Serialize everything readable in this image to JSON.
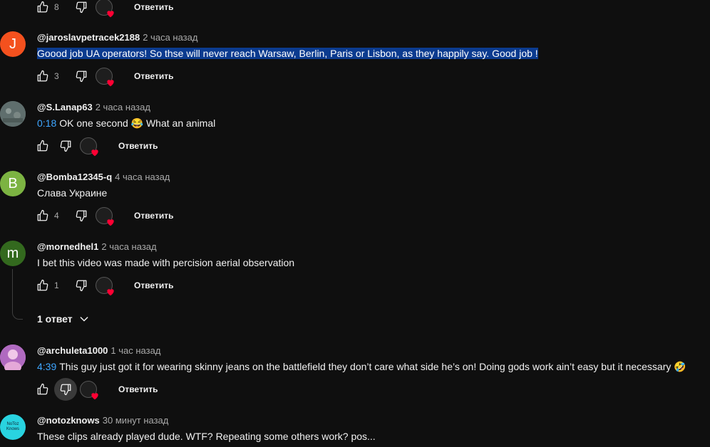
{
  "comments": [
    {
      "author": "",
      "time": "",
      "likes": "8",
      "reply_label": "Ответить"
    },
    {
      "avatar_letter": "J",
      "avatar_color": "#f4511e",
      "author": "@jaroslavpetracek2188",
      "time": "2 часа назад",
      "text": "Goood job UA operators! So thse will never reach Warsaw, Berlin, Paris or Lisbon, as they happily say. Good job !",
      "likes": "3",
      "reply_label": "Ответить"
    },
    {
      "avatar_color": "#6b7a7a",
      "author": "@S.Lanap63",
      "time": "2 часа назад",
      "timestamp_link": "0:18",
      "text": "OK one second 😂  What an animal",
      "likes": "",
      "reply_label": "Ответить"
    },
    {
      "avatar_letter": "B",
      "avatar_color": "#7cb342",
      "author": "@Bomba12345-q",
      "time": "4 часа назад",
      "text": "Слава Украине",
      "likes": "4",
      "reply_label": "Ответить"
    },
    {
      "avatar_letter": "m",
      "avatar_color": "#33691e",
      "author": "@mornedhel1",
      "time": "2 часа назад",
      "text": "I bet this video was made with percision aerial observation",
      "likes": "1",
      "reply_label": "Ответить",
      "replies_label": "1 ответ"
    },
    {
      "avatar_color": "#c27bd0",
      "author": "@archuleta1000",
      "time": "1 час назад",
      "timestamp_link": "4:39",
      "text": "This guy just got it for wearing skinny jeans on the battlefield they don’t care what side he’s on! Doing gods work ain’t easy but it necessary 🤣",
      "likes": "",
      "reply_label": "Ответить"
    },
    {
      "avatar_color": "#29d3e0",
      "avatar_logo_text": "NoToz Knows",
      "author": "@notozknows",
      "time": "30 минут назад",
      "text": "These clips already played dude.  WTF?  Repeating some others work?  pos..."
    }
  ],
  "colors": {
    "background": "#0f0f0f",
    "link": "#3ea6ff",
    "highlight": "#0b3b8f",
    "heart": "#ff0033"
  }
}
